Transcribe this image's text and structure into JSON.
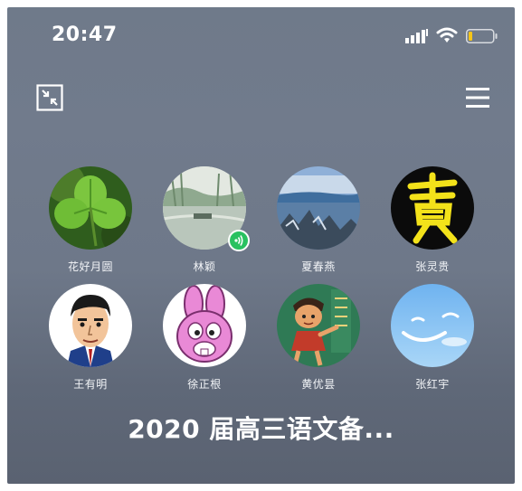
{
  "status_bar": {
    "time": "20:47",
    "icons": [
      "signal-icon",
      "wifi-icon",
      "battery-icon"
    ],
    "battery_color": "#f5c518"
  },
  "toolbar": {
    "minimize_icon": "minimize-window-icon",
    "menu_icon": "menu-icon"
  },
  "participants": [
    {
      "name": "花好月圆",
      "avatar": "clover-avatar"
    },
    {
      "name": "林颖",
      "avatar": "lake-avatar",
      "speaking": true
    },
    {
      "name": "夏春燕",
      "avatar": "landscape-avatar"
    },
    {
      "name": "张灵贵",
      "avatar": "calligraphy-avatar"
    },
    {
      "name": "王有明",
      "avatar": "cartoon-man-avatar"
    },
    {
      "name": "徐正根",
      "avatar": "pink-rabbit-avatar"
    },
    {
      "name": "黄优昙",
      "avatar": "cartoon-boy-avatar"
    },
    {
      "name": "张红宇",
      "avatar": "blue-sky-avatar"
    }
  ],
  "meeting": {
    "title": "2020 届高三语文备..."
  },
  "colors": {
    "background": "#6f7a8a",
    "speaking_indicator": "#29c160",
    "text": "#ffffff"
  }
}
